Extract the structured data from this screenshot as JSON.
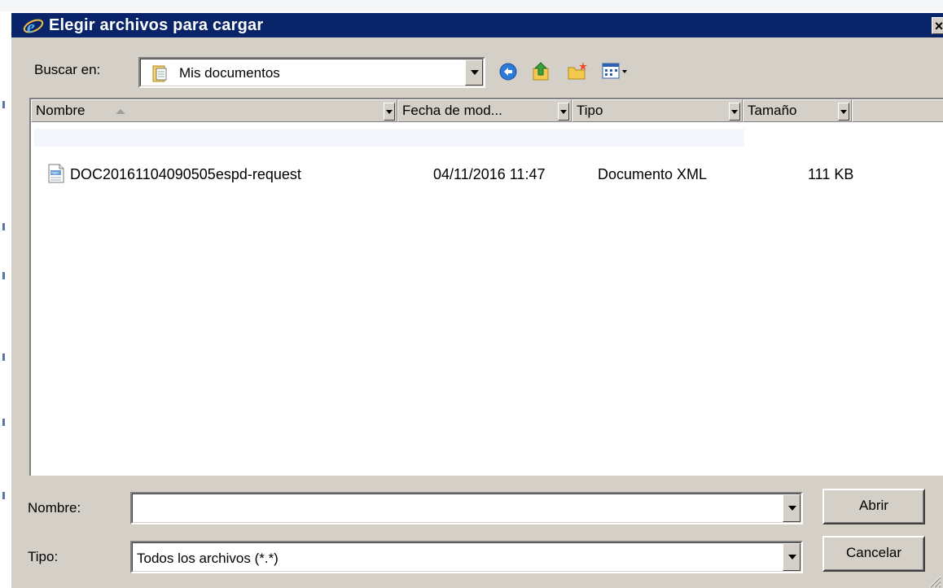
{
  "dialog": {
    "title": "Elegir archivos para cargar",
    "close_glyph": "×"
  },
  "toolbar": {
    "look_in_label": "Buscar en:",
    "look_in_value": "Mis documentos",
    "look_in_icon": "folder-icon",
    "back_icon": "back-arrow-icon",
    "up_icon": "up-folder-icon",
    "new_folder_icon": "new-folder-icon",
    "views_icon": "views-menu-icon"
  },
  "columns": [
    {
      "label": "Nombre"
    },
    {
      "label": "Fecha de mod..."
    },
    {
      "label": "Tipo"
    },
    {
      "label": "Tamaño"
    }
  ],
  "files": [
    {
      "name": "DOC20161104090505espd-request",
      "date": "04/11/2016 11:47",
      "type": "Documento XML",
      "size": "111 KB",
      "icon": "xml-file-icon"
    }
  ],
  "form": {
    "filename_label": "Nombre:",
    "filename_value": "",
    "filetype_label": "Tipo:",
    "filetype_value": "Todos los archivos (*.*)",
    "open_label": "Abrir",
    "cancel_label": "Cancelar"
  },
  "colors": {
    "titlebar": "#0a246a",
    "face": "#d4d0c8",
    "window": "#ffffff"
  }
}
